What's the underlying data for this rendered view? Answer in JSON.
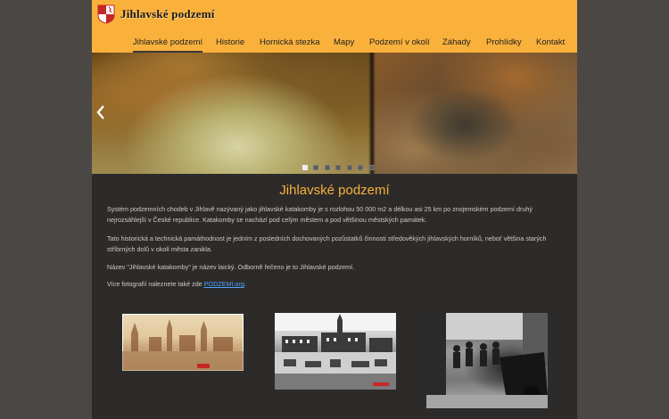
{
  "site": {
    "title": "Jihlavské podzemí"
  },
  "nav": [
    {
      "label": "Jihlavské podzemí",
      "active": true
    },
    {
      "label": "Historie"
    },
    {
      "label": "Hornická stezka"
    },
    {
      "label": "Mapy"
    },
    {
      "label": "Podzemí v okolí"
    },
    {
      "label": "Záhady"
    },
    {
      "label": "Prohlídky"
    },
    {
      "label": "Kontakt"
    }
  ],
  "slider": {
    "prev_icon": "chevron-left-icon",
    "dots_count": 7,
    "active_dot": 1
  },
  "main": {
    "heading": "Jihlavské podzemí",
    "p1": "Systém podzemních chodeb v Jihlavě nazývaný jako jihlavské katakomby je s rozlohou 50 000 m2 a délkou asi 25 km po znojemském podzemí druhý nejrozsáhlejší v České republice. Katakomby se nachází pod celým městem a pod většinou městských památek.",
    "p2": "Tato historická a technická památhodnost je jedním z posledních dochovaných pozůstatků činnosti středověkých jihlavských horníků, neboť většina starých stříbrných dolů v okolí města zanikla.",
    "p3": "Název \"Jihlavské katakomby\" je název laický. Odborně řečeno je to Jihlavské podzemí.",
    "p4_prefix": "Více fotografií naleznete také zde",
    "p4_link": "PODZEMI.org",
    "p4_suffix": "."
  },
  "colors": {
    "header_bg": "#f9b13c",
    "heading": "#f9b13c",
    "page_bg": "#2c2b2a",
    "body_bg": "#4a4744",
    "link": "#4ea3ff"
  }
}
